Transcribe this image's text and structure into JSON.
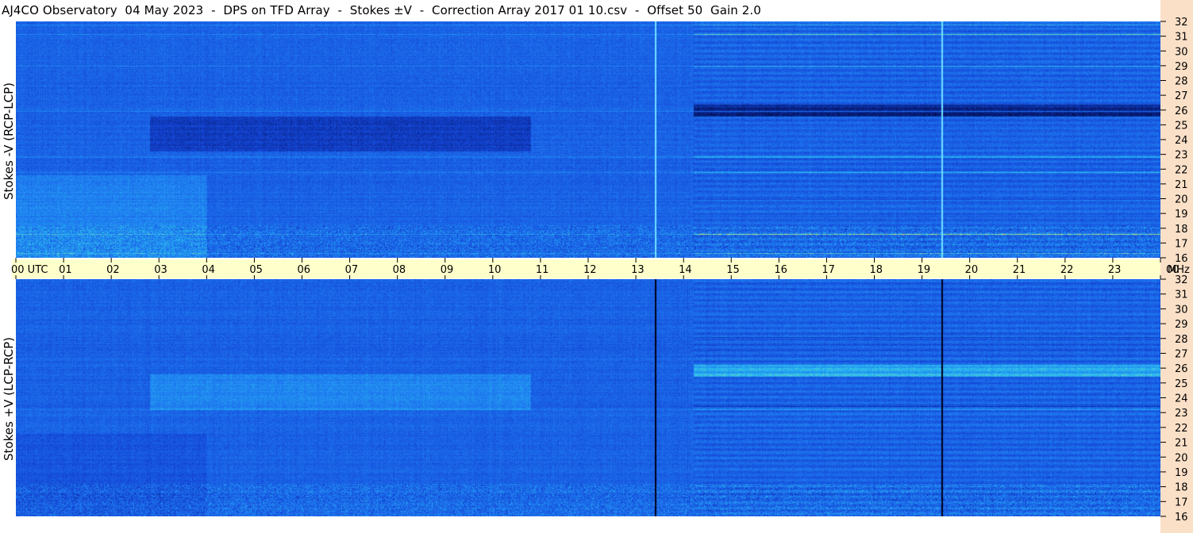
{
  "header": {
    "title": "AJ4CO Observatory  04 May 2023  -  DPS on TFD Array  -  Stokes ±V  -  Correction Array 2017 01 10.csv  -  Offset 50  Gain 2.0"
  },
  "panels": {
    "top_label": "Stokes -V (RCP-LCP)",
    "bottom_label": "Stokes +V (LCP-RCP)"
  },
  "colors": {
    "background": "#ffffff",
    "utc_bar": "#ffffcc",
    "freq_strip": "#fbe0c8",
    "colormap_low": "#000033",
    "colormap_mid": "#1a5ae0",
    "colormap_high": "#ffff40"
  },
  "chart_data": {
    "type": "heatmap",
    "x_label": "UTC",
    "x_tick_labels": [
      "00 UTC",
      "01",
      "02",
      "03",
      "04",
      "05",
      "06",
      "07",
      "08",
      "09",
      "10",
      "11",
      "12",
      "13",
      "14",
      "15",
      "16",
      "17",
      "18",
      "19",
      "20",
      "21",
      "22",
      "23",
      "00"
    ],
    "x_values_hours": [
      0,
      1,
      2,
      3,
      4,
      5,
      6,
      7,
      8,
      9,
      10,
      11,
      12,
      13,
      14,
      15,
      16,
      17,
      18,
      19,
      20,
      21,
      22,
      23,
      24
    ],
    "xlim": [
      0,
      24
    ],
    "y_unit": "MHz",
    "y_tick_labels": [
      "32",
      "31",
      "30",
      "29",
      "28",
      "27",
      "26",
      "25",
      "24",
      "23",
      "22",
      "21",
      "20",
      "19",
      "18",
      "17",
      "16"
    ],
    "y_values_mhz": [
      32,
      31,
      30,
      29,
      28,
      27,
      26,
      25,
      24,
      23,
      22,
      21,
      20,
      19,
      18,
      17,
      16
    ],
    "ylim": [
      16,
      32
    ],
    "spikes_utc": [
      13.4,
      19.4
    ]
  }
}
